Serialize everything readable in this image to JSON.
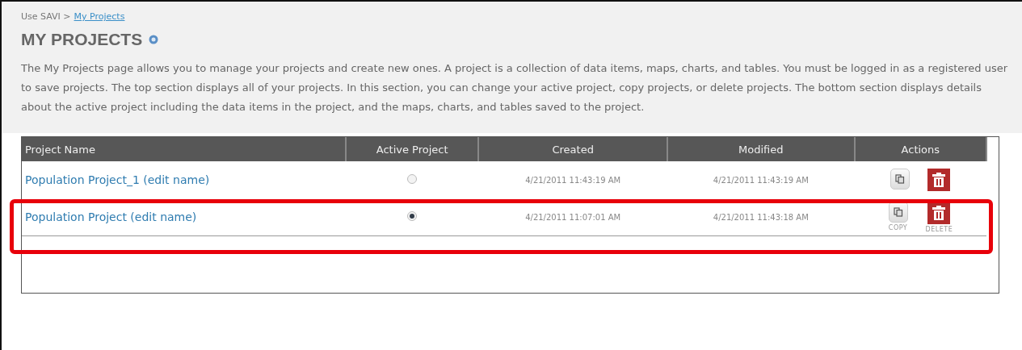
{
  "breadcrumb": {
    "root": "Use SAVI >",
    "current": "My Projects"
  },
  "title": "MY PROJECTS",
  "description": "The My Projects page allows you to manage your projects and create new ones.  A project is a collection of data items, maps, charts, and tables. You must be logged in as a registered user to save projects. The top section displays all of your projects.  In this section, you can change your active project, copy projects, or delete projects. The bottom section displays details about the active project including the data items in the project, and the maps, charts, and tables saved to the project.",
  "table": {
    "columns": [
      "Project Name",
      "Active Project",
      "Created",
      "Modified",
      "Actions"
    ],
    "rows": [
      {
        "name": "Population Project_1 (edit name)",
        "selected": false,
        "created": "4/21/2011 11:43:19 AM",
        "modified": "4/21/2011 11:43:19 AM",
        "highlighted": false
      },
      {
        "name": "Population Project (edit name)",
        "selected": true,
        "created": "4/21/2011 11:07:01 AM",
        "modified": "4/21/2011 11:43:18 AM",
        "highlighted": true,
        "copy_label": "COPY",
        "delete_label": "DELETE"
      }
    ]
  }
}
